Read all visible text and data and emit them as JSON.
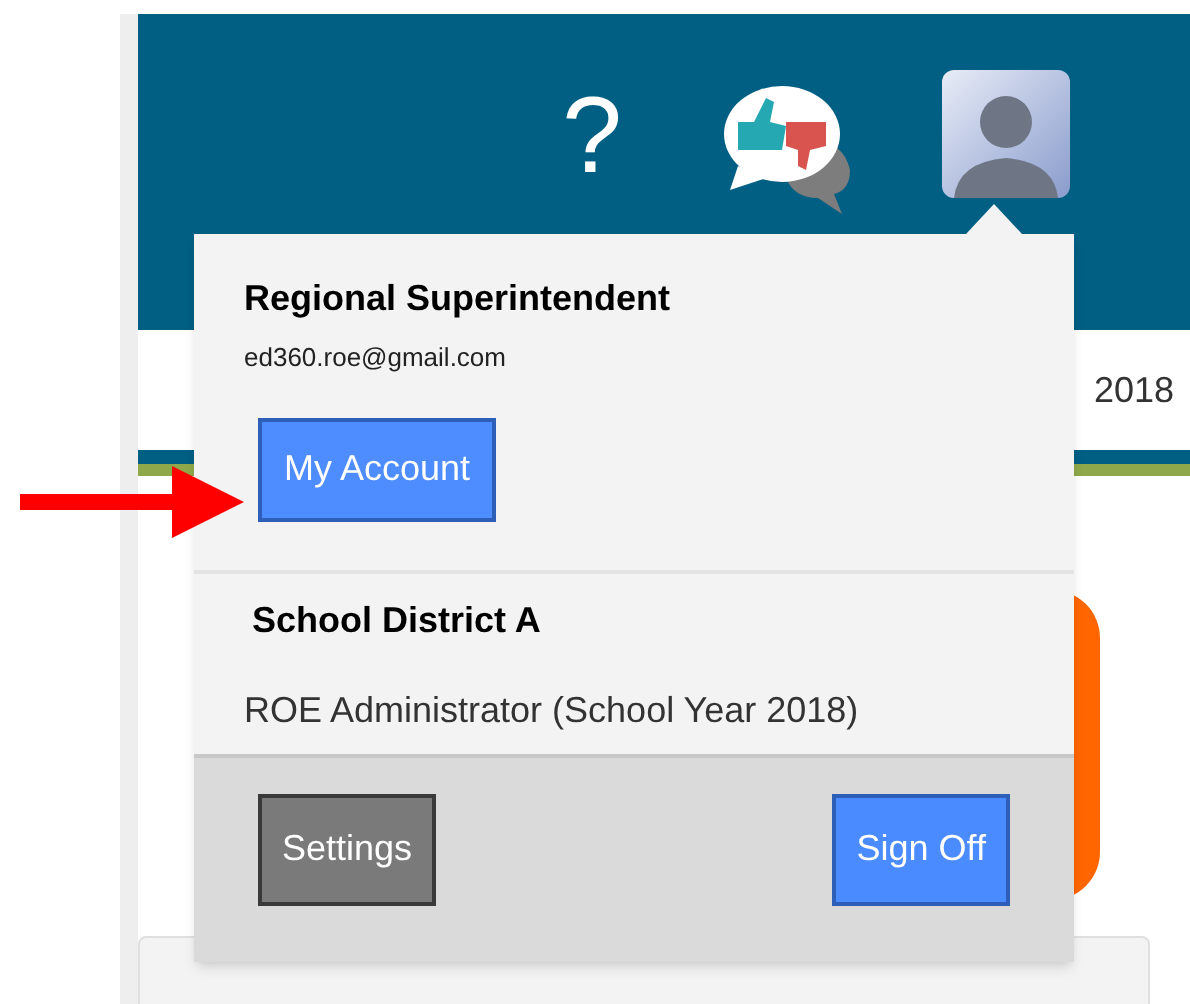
{
  "header": {
    "help_label": "?"
  },
  "background": {
    "year_text": "2018"
  },
  "account_menu": {
    "title": "Regional Superintendent",
    "email": "ed360.roe@gmail.com",
    "account_button": "My Account",
    "district": "School District A",
    "role": "ROE Administrator (School Year 2018)",
    "footer_buttons": [
      {
        "label": "Settings",
        "kind": "secondary"
      },
      {
        "label": "Sign Off",
        "kind": "primary"
      }
    ]
  }
}
